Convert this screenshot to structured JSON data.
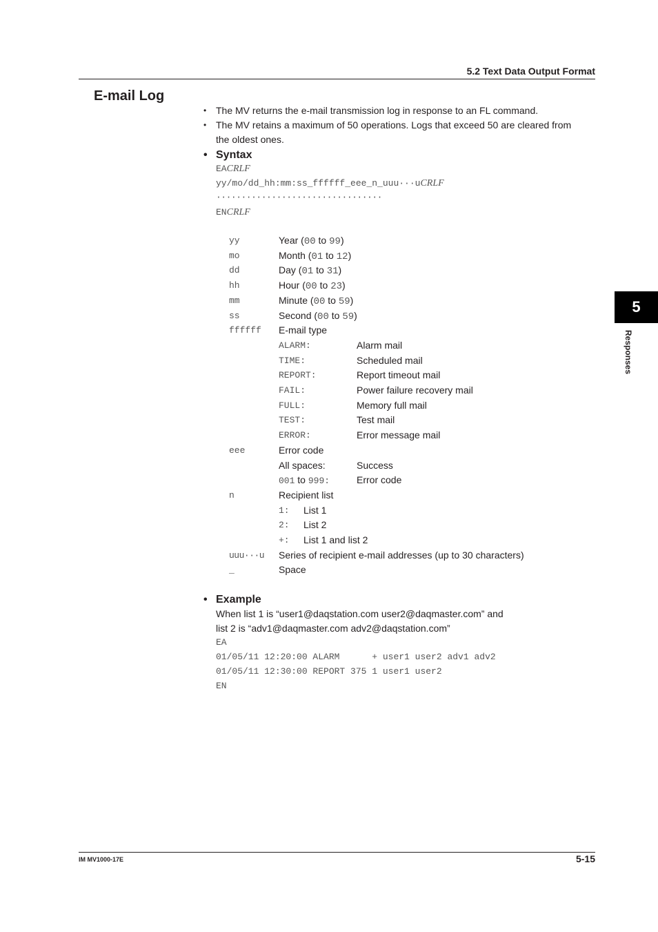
{
  "header": {
    "section": "5.2  Text Data Output Format"
  },
  "title": "E-mail Log",
  "intro": [
    {
      "bullet": "•",
      "lines": [
        "The MV returns the e-mail transmission log in response to an FL command."
      ]
    },
    {
      "bullet": "•",
      "lines": [
        "The MV retains a maximum of 50 operations. Logs that exceed 50 are cleared from",
        "the oldest ones."
      ]
    }
  ],
  "syntax": {
    "heading": "Syntax",
    "bullet": "•",
    "lines": [
      {
        "code": "EA",
        "suffix": "CRLF"
      },
      {
        "code": "yy/mo/dd_hh:mm:ss_ffffff_eee_n_uuu···u",
        "suffix": "CRLF"
      },
      {
        "code": "·································",
        "suffix": ""
      },
      {
        "code": "EN",
        "suffix": "CRLF"
      }
    ]
  },
  "fields": [
    {
      "key": "yy",
      "label": "Year (",
      "from": "00",
      "to_word": " to ",
      "to": "99",
      "end": ")"
    },
    {
      "key": "mo",
      "label": "Month (",
      "from": "01",
      "to_word": " to ",
      "to": "12",
      "end": ")"
    },
    {
      "key": "dd",
      "label": "Day (",
      "from": "01",
      "to_word": " to ",
      "to": "31",
      "end": ")"
    },
    {
      "key": "hh",
      "label": "Hour (",
      "from": "00",
      "to_word": " to ",
      "to": "23",
      "end": ")"
    },
    {
      "key": "mm",
      "label": "Minute (",
      "from": "00",
      "to_word": " to ",
      "to": "59",
      "end": ")"
    },
    {
      "key": "ss",
      "label": "Second (",
      "from": "00",
      "to_word": " to ",
      "to": "59",
      "end": ")"
    }
  ],
  "mail_type": {
    "key": "ffffff",
    "label": "E-mail type",
    "items": [
      {
        "code": "ALARM:",
        "desc": "Alarm mail"
      },
      {
        "code": "TIME:",
        "desc": "Scheduled mail"
      },
      {
        "code": "REPORT:",
        "desc": "Report timeout mail"
      },
      {
        "code": "FAIL:",
        "desc": "Power failure recovery mail"
      },
      {
        "code": "FULL:",
        "desc": "Memory full mail"
      },
      {
        "code": "TEST:",
        "desc": "Test mail"
      },
      {
        "code": "ERROR:",
        "desc": "Error message mail"
      }
    ]
  },
  "error_code": {
    "key": "eee",
    "label": "Error code",
    "all_spaces_label": "All spaces:",
    "all_spaces_desc": "Success",
    "range_from": "001",
    "range_to_word": " to ",
    "range_to": "999:",
    "range_desc": "Error code"
  },
  "recipient": {
    "key": "n",
    "label": "Recipient list",
    "items": [
      {
        "code": "1:",
        "desc": "List 1"
      },
      {
        "code": "2:",
        "desc": "List 2"
      },
      {
        "code": "+:",
        "desc": "List 1 and list 2"
      }
    ]
  },
  "addresses": {
    "key": "uuu···u",
    "label": "Series of recipient e-mail addresses (up to 30 characters)"
  },
  "space": {
    "key": "_",
    "label": "Space"
  },
  "example": {
    "heading": "Example",
    "bullet": "•",
    "desc": [
      "When list 1 is “user1@daqstation.com user2@daqmaster.com” and",
      "list 2 is “adv1@daqmaster.com adv2@daqstation.com”"
    ],
    "code": [
      "EA",
      "01/05/11 12:20:00 ALARM      + user1 user2 adv1 adv2",
      "01/05/11 12:30:00 REPORT 375 1 user1 user2",
      "EN"
    ]
  },
  "side_tab": {
    "number": "5",
    "label": "Responses"
  },
  "footer": {
    "doc_id": "IM MV1000-17E",
    "page": "5-15"
  }
}
